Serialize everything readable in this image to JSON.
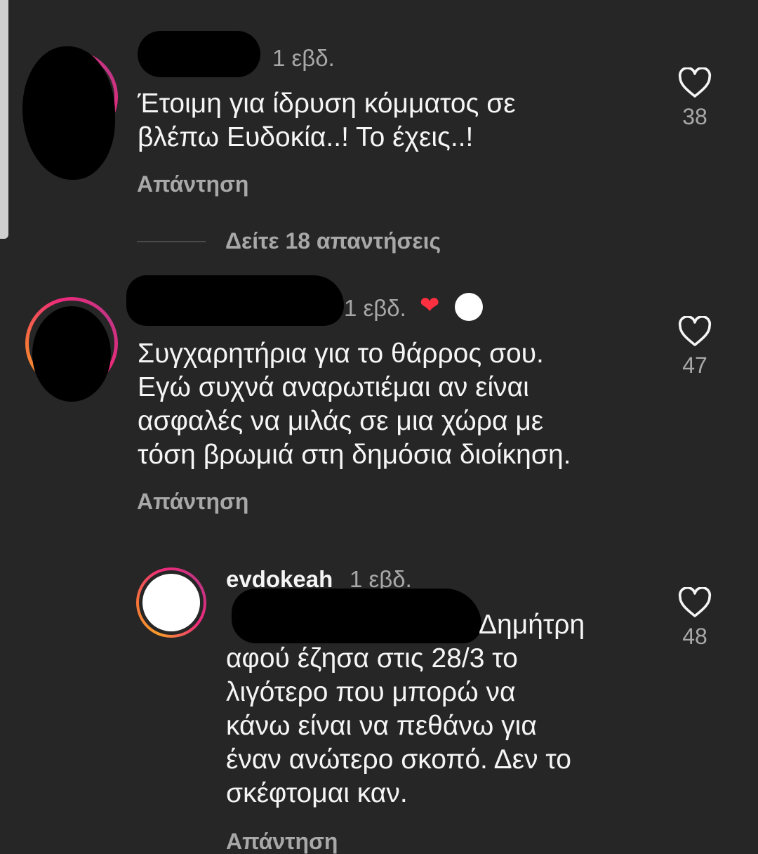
{
  "comments": [
    {
      "time": "1 εβδ.",
      "text": "Έτοιμη για ίδρυση κόμματος σε\nβλέπω Ευδοκία..! Το έχεις..!",
      "reply_label": "Απάντηση",
      "likes": "38"
    },
    {
      "time": "1 εβδ.",
      "text": "Συγχαρητήρια για το θάρρος σου.\nΕγώ συχνά αναρωτιέμαι αν είναι\nασφαλές να μιλάς σε μια χώρα με\nτόση βρωμιά στη δημόσια διοίκηση.",
      "reply_label": "Απάντηση",
      "likes": "47"
    }
  ],
  "view_replies": "Δείτε 18 απαντήσεις",
  "reply": {
    "username": "evdokeah",
    "time": "1 εβδ.",
    "text_first_line": "Δημήτρη",
    "text_rest": "αφού έζησα στις 28/3 το\nλιγότερο που μπορώ να\nκάνω είναι να πεθάνω για\nέναν ανώτερο σκοπό. Δεν το\nσκέφτομαι καν.",
    "reply_label": "Απάντηση",
    "likes": "48"
  },
  "icons": {
    "like": "heart-outline-icon",
    "liked_by_author": "red-heart-icon"
  },
  "colors": {
    "background": "#262626",
    "secondary_text": "#a8a8a8",
    "story_ring_start": "#f99b2b",
    "story_ring_end": "#c13584",
    "liked_heart": "#ff3040"
  }
}
